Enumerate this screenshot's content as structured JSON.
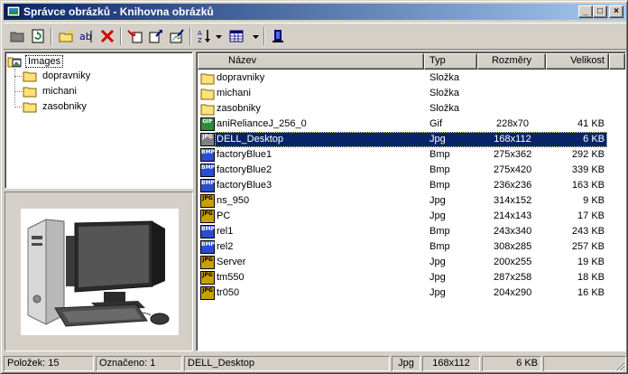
{
  "window": {
    "title": "Správce obrázků - Knihovna obrázků",
    "controls": {
      "minimize": "_",
      "maximize": "□",
      "close": "×"
    }
  },
  "toolbar": {
    "buttons": [
      "folder-closed-icon",
      "refresh-icon",
      "new-folder-icon",
      "rename-icon",
      "delete-icon",
      "import-icon",
      "export-icon",
      "edit-image-icon",
      "sort-icon",
      "view-icon",
      "exit-icon"
    ]
  },
  "tree": {
    "root": "Images",
    "children": [
      "dopravniky",
      "michani",
      "zasobniky"
    ]
  },
  "list": {
    "columns": {
      "name": "Název",
      "type": "Typ",
      "dimensions": "Rozměry",
      "size": "Velikost"
    },
    "rows": [
      {
        "name": "dopravniky",
        "type": "Složka",
        "dim": "",
        "size": "",
        "icon": "folder"
      },
      {
        "name": "michani",
        "type": "Složka",
        "dim": "",
        "size": "",
        "icon": "folder"
      },
      {
        "name": "zasobniky",
        "type": "Složka",
        "dim": "",
        "size": "",
        "icon": "folder"
      },
      {
        "name": "aniRelianceJ_256_0",
        "type": "Gif",
        "dim": "228x70",
        "size": "41 KB",
        "icon": "gif"
      },
      {
        "name": "DELL_Desktop",
        "type": "Jpg",
        "dim": "168x112",
        "size": "6 KB",
        "icon": "jpg-selected"
      },
      {
        "name": "factoryBlue1",
        "type": "Bmp",
        "dim": "275x362",
        "size": "292 KB",
        "icon": "bmp"
      },
      {
        "name": "factoryBlue2",
        "type": "Bmp",
        "dim": "275x420",
        "size": "339 KB",
        "icon": "bmp"
      },
      {
        "name": "factoryBlue3",
        "type": "Bmp",
        "dim": "236x236",
        "size": "163 KB",
        "icon": "bmp"
      },
      {
        "name": "ns_950",
        "type": "Jpg",
        "dim": "314x152",
        "size": "9 KB",
        "icon": "jpg"
      },
      {
        "name": "PC",
        "type": "Jpg",
        "dim": "214x143",
        "size": "17 KB",
        "icon": "jpg"
      },
      {
        "name": "rel1",
        "type": "Bmp",
        "dim": "243x340",
        "size": "243 KB",
        "icon": "bmp"
      },
      {
        "name": "rel2",
        "type": "Bmp",
        "dim": "308x285",
        "size": "257 KB",
        "icon": "bmp"
      },
      {
        "name": "Server",
        "type": "Jpg",
        "dim": "200x255",
        "size": "19 KB",
        "icon": "jpg"
      },
      {
        "name": "tm550",
        "type": "Jpg",
        "dim": "287x258",
        "size": "18 KB",
        "icon": "jpg"
      },
      {
        "name": "tr050",
        "type": "Jpg",
        "dim": "204x290",
        "size": "16 KB",
        "icon": "jpg"
      }
    ]
  },
  "status": {
    "items_count": "Položek: 15",
    "selected_count": "Označeno: 1",
    "selected_name": "DELL_Desktop",
    "selected_type": "Jpg",
    "selected_dim": "168x112",
    "selected_size": "6 KB"
  },
  "colors": {
    "titlebar_start": "#0a246a",
    "titlebar_end": "#a6caf0",
    "selection": "#0a246a",
    "face": "#d4d0c8",
    "folder": "#ffe27a"
  }
}
